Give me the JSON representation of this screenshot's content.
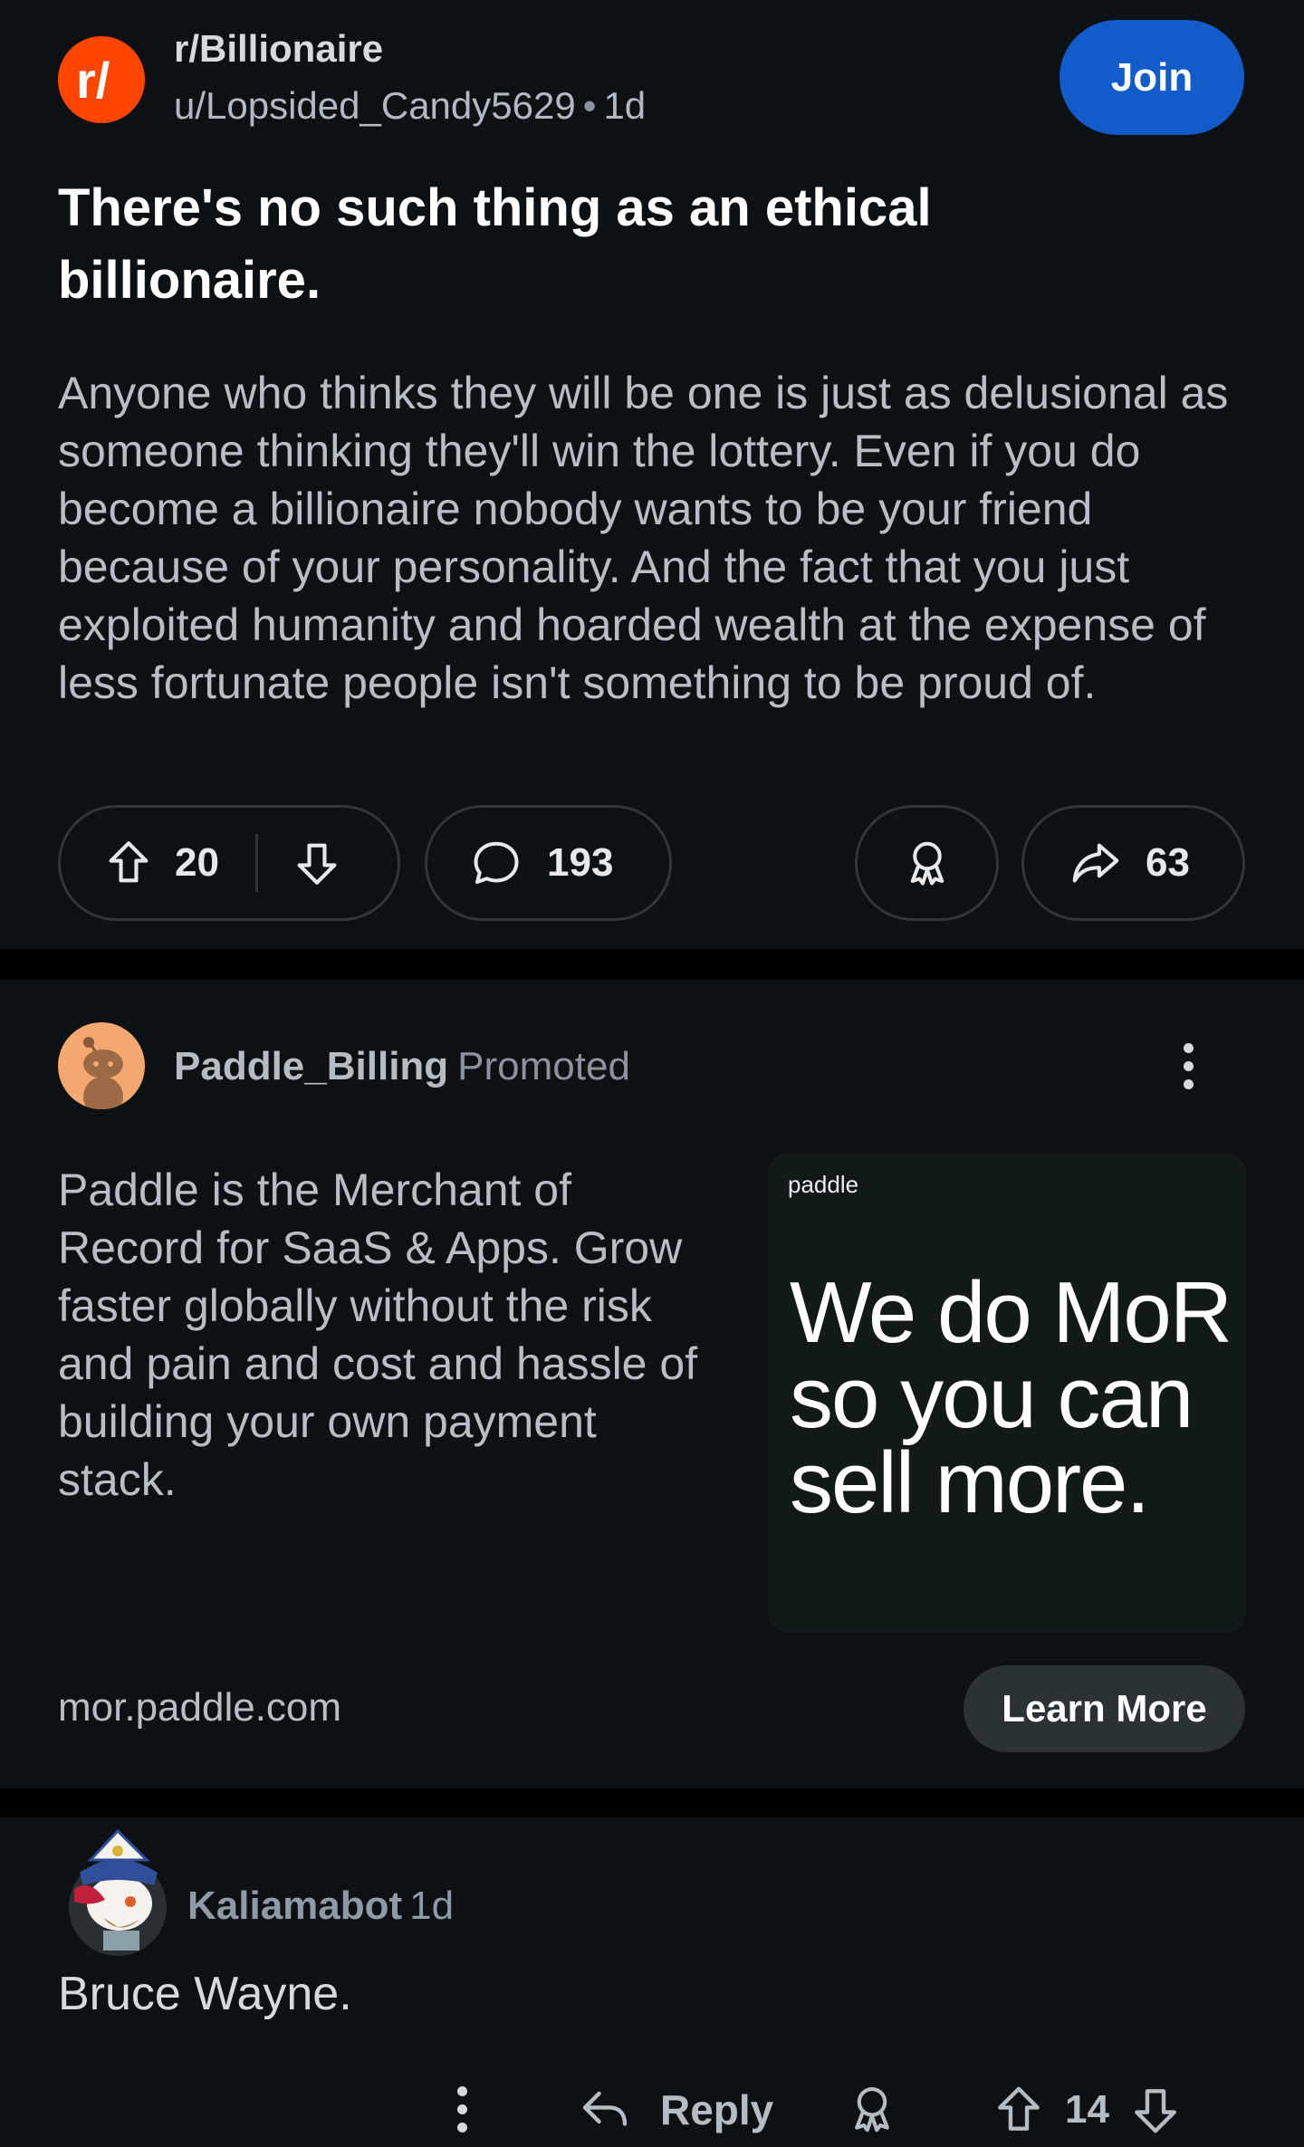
{
  "post": {
    "subreddit": "r/Billionaire",
    "author": "u/Lopsided_Candy5629",
    "separator": "•",
    "age": "1d",
    "join_label": "Join",
    "title": "There's no such thing as an ethical billionaire.",
    "body": "Anyone who thinks they will be one is just as delusional as someone thinking they'll win the lottery. Even if you do become a billionaire nobody wants to be your friend because of your personality. And the fact that you just exploited humanity and hoarded wealth at the expense of less fortunate people isn't something to be proud of.",
    "upvotes": "20",
    "comments": "193",
    "shares": "63"
  },
  "ad": {
    "advertiser": "Paddle_Billing",
    "promoted_label": "Promoted",
    "text": "Paddle is the Merchant of Record for SaaS & Apps. Grow faster globally without the risk and pain and cost and hassle of building your own payment stack.",
    "image_logo": "paddle",
    "image_headline": "We do MoR so you can sell more.",
    "url": "mor.paddle.com",
    "cta_label": "Learn More"
  },
  "comment": {
    "author": "Kaliamabot",
    "age": "1d",
    "body": "Bruce Wayne.",
    "reply_label": "Reply",
    "votes": "14"
  },
  "colors": {
    "background": "#0e1113",
    "join_button": "#115bca",
    "subreddit_avatar": "#ff4500",
    "ad_avatar": "#f4a86f"
  }
}
